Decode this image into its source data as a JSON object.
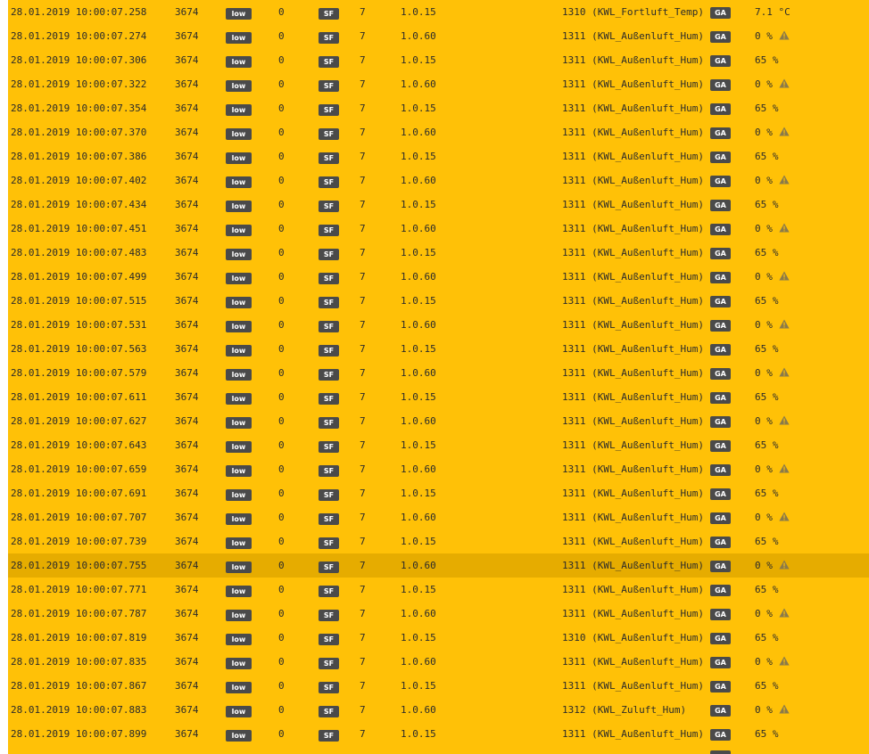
{
  "badges": {
    "priority": "low",
    "frame_format": "SF",
    "target_type": "GA"
  },
  "colors": {
    "row_bg": "#ffc107",
    "selected_row_bg": "#e6ac00",
    "badge_bg": "#4a4a4a",
    "warning_icon": "#8a7a4a"
  },
  "selected_row_index": 23,
  "rows": [
    {
      "timestamp": "28.01.2019 10:00:07.258",
      "source": "3674",
      "repeat": "0",
      "hops": "7",
      "physical_address": "1.0.15",
      "group_address": "1310 (KWL_Fortluft_Temp)",
      "value": "7.1 °C",
      "warning": false
    },
    {
      "timestamp": "28.01.2019 10:00:07.274",
      "source": "3674",
      "repeat": "0",
      "hops": "7",
      "physical_address": "1.0.60",
      "group_address": "1311 (KWL_Außenluft_Hum)",
      "value": "0 %",
      "warning": true
    },
    {
      "timestamp": "28.01.2019 10:00:07.306",
      "source": "3674",
      "repeat": "0",
      "hops": "7",
      "physical_address": "1.0.15",
      "group_address": "1311 (KWL_Außenluft_Hum)",
      "value": "65 %",
      "warning": false
    },
    {
      "timestamp": "28.01.2019 10:00:07.322",
      "source": "3674",
      "repeat": "0",
      "hops": "7",
      "physical_address": "1.0.60",
      "group_address": "1311 (KWL_Außenluft_Hum)",
      "value": "0 %",
      "warning": true
    },
    {
      "timestamp": "28.01.2019 10:00:07.354",
      "source": "3674",
      "repeat": "0",
      "hops": "7",
      "physical_address": "1.0.15",
      "group_address": "1311 (KWL_Außenluft_Hum)",
      "value": "65 %",
      "warning": false
    },
    {
      "timestamp": "28.01.2019 10:00:07.370",
      "source": "3674",
      "repeat": "0",
      "hops": "7",
      "physical_address": "1.0.60",
      "group_address": "1311 (KWL_Außenluft_Hum)",
      "value": "0 %",
      "warning": true
    },
    {
      "timestamp": "28.01.2019 10:00:07.386",
      "source": "3674",
      "repeat": "0",
      "hops": "7",
      "physical_address": "1.0.15",
      "group_address": "1311 (KWL_Außenluft_Hum)",
      "value": "65 %",
      "warning": false
    },
    {
      "timestamp": "28.01.2019 10:00:07.402",
      "source": "3674",
      "repeat": "0",
      "hops": "7",
      "physical_address": "1.0.60",
      "group_address": "1311 (KWL_Außenluft_Hum)",
      "value": "0 %",
      "warning": true
    },
    {
      "timestamp": "28.01.2019 10:00:07.434",
      "source": "3674",
      "repeat": "0",
      "hops": "7",
      "physical_address": "1.0.15",
      "group_address": "1311 (KWL_Außenluft_Hum)",
      "value": "65 %",
      "warning": false
    },
    {
      "timestamp": "28.01.2019 10:00:07.451",
      "source": "3674",
      "repeat": "0",
      "hops": "7",
      "physical_address": "1.0.60",
      "group_address": "1311 (KWL_Außenluft_Hum)",
      "value": "0 %",
      "warning": true
    },
    {
      "timestamp": "28.01.2019 10:00:07.483",
      "source": "3674",
      "repeat": "0",
      "hops": "7",
      "physical_address": "1.0.15",
      "group_address": "1311 (KWL_Außenluft_Hum)",
      "value": "65 %",
      "warning": false
    },
    {
      "timestamp": "28.01.2019 10:00:07.499",
      "source": "3674",
      "repeat": "0",
      "hops": "7",
      "physical_address": "1.0.60",
      "group_address": "1311 (KWL_Außenluft_Hum)",
      "value": "0 %",
      "warning": true
    },
    {
      "timestamp": "28.01.2019 10:00:07.515",
      "source": "3674",
      "repeat": "0",
      "hops": "7",
      "physical_address": "1.0.15",
      "group_address": "1311 (KWL_Außenluft_Hum)",
      "value": "65 %",
      "warning": false
    },
    {
      "timestamp": "28.01.2019 10:00:07.531",
      "source": "3674",
      "repeat": "0",
      "hops": "7",
      "physical_address": "1.0.60",
      "group_address": "1311 (KWL_Außenluft_Hum)",
      "value": "0 %",
      "warning": true
    },
    {
      "timestamp": "28.01.2019 10:00:07.563",
      "source": "3674",
      "repeat": "0",
      "hops": "7",
      "physical_address": "1.0.15",
      "group_address": "1311 (KWL_Außenluft_Hum)",
      "value": "65 %",
      "warning": false
    },
    {
      "timestamp": "28.01.2019 10:00:07.579",
      "source": "3674",
      "repeat": "0",
      "hops": "7",
      "physical_address": "1.0.60",
      "group_address": "1311 (KWL_Außenluft_Hum)",
      "value": "0 %",
      "warning": true
    },
    {
      "timestamp": "28.01.2019 10:00:07.611",
      "source": "3674",
      "repeat": "0",
      "hops": "7",
      "physical_address": "1.0.15",
      "group_address": "1311 (KWL_Außenluft_Hum)",
      "value": "65 %",
      "warning": false
    },
    {
      "timestamp": "28.01.2019 10:00:07.627",
      "source": "3674",
      "repeat": "0",
      "hops": "7",
      "physical_address": "1.0.60",
      "group_address": "1311 (KWL_Außenluft_Hum)",
      "value": "0 %",
      "warning": true
    },
    {
      "timestamp": "28.01.2019 10:00:07.643",
      "source": "3674",
      "repeat": "0",
      "hops": "7",
      "physical_address": "1.0.15",
      "group_address": "1311 (KWL_Außenluft_Hum)",
      "value": "65 %",
      "warning": false
    },
    {
      "timestamp": "28.01.2019 10:00:07.659",
      "source": "3674",
      "repeat": "0",
      "hops": "7",
      "physical_address": "1.0.60",
      "group_address": "1311 (KWL_Außenluft_Hum)",
      "value": "0 %",
      "warning": true
    },
    {
      "timestamp": "28.01.2019 10:00:07.691",
      "source": "3674",
      "repeat": "0",
      "hops": "7",
      "physical_address": "1.0.15",
      "group_address": "1311 (KWL_Außenluft_Hum)",
      "value": "65 %",
      "warning": false
    },
    {
      "timestamp": "28.01.2019 10:00:07.707",
      "source": "3674",
      "repeat": "0",
      "hops": "7",
      "physical_address": "1.0.60",
      "group_address": "1311 (KWL_Außenluft_Hum)",
      "value": "0 %",
      "warning": true
    },
    {
      "timestamp": "28.01.2019 10:00:07.739",
      "source": "3674",
      "repeat": "0",
      "hops": "7",
      "physical_address": "1.0.15",
      "group_address": "1311 (KWL_Außenluft_Hum)",
      "value": "65 %",
      "warning": false
    },
    {
      "timestamp": "28.01.2019 10:00:07.755",
      "source": "3674",
      "repeat": "0",
      "hops": "7",
      "physical_address": "1.0.60",
      "group_address": "1311 (KWL_Außenluft_Hum)",
      "value": "0 %",
      "warning": true
    },
    {
      "timestamp": "28.01.2019 10:00:07.771",
      "source": "3674",
      "repeat": "0",
      "hops": "7",
      "physical_address": "1.0.15",
      "group_address": "1311 (KWL_Außenluft_Hum)",
      "value": "65 %",
      "warning": false
    },
    {
      "timestamp": "28.01.2019 10:00:07.787",
      "source": "3674",
      "repeat": "0",
      "hops": "7",
      "physical_address": "1.0.60",
      "group_address": "1311 (KWL_Außenluft_Hum)",
      "value": "0 %",
      "warning": true
    },
    {
      "timestamp": "28.01.2019 10:00:07.819",
      "source": "3674",
      "repeat": "0",
      "hops": "7",
      "physical_address": "1.0.15",
      "group_address": "1310 (KWL_Außenluft_Hum)",
      "value": "65 %",
      "warning": false
    },
    {
      "timestamp": "28.01.2019 10:00:07.835",
      "source": "3674",
      "repeat": "0",
      "hops": "7",
      "physical_address": "1.0.60",
      "group_address": "1311 (KWL_Außenluft_Hum)",
      "value": "0 %",
      "warning": true
    },
    {
      "timestamp": "28.01.2019 10:00:07.867",
      "source": "3674",
      "repeat": "0",
      "hops": "7",
      "physical_address": "1.0.15",
      "group_address": "1311 (KWL_Außenluft_Hum)",
      "value": "65 %",
      "warning": false
    },
    {
      "timestamp": "28.01.2019 10:00:07.883",
      "source": "3674",
      "repeat": "0",
      "hops": "7",
      "physical_address": "1.0.60",
      "group_address": "1312 (KWL_Zuluft_Hum)",
      "value": "0 %",
      "warning": true
    },
    {
      "timestamp": "28.01.2019 10:00:07.899",
      "source": "3674",
      "repeat": "0",
      "hops": "7",
      "physical_address": "1.0.15",
      "group_address": "1311 (KWL_Außenluft_Hum)",
      "value": "65 %",
      "warning": false
    }
  ]
}
